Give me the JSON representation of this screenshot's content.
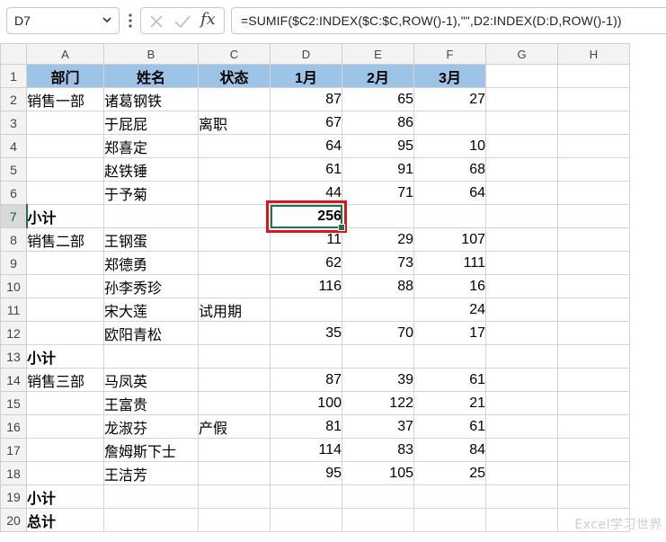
{
  "formula_bar": {
    "name_box": "D7",
    "formula": "=SUMIF($C2:INDEX($C:$C,ROW()-1),\"\",D2:INDEX(D:D,ROW()-1))",
    "fx_label": "fx"
  },
  "columns": [
    "A",
    "B",
    "C",
    "D",
    "E",
    "F",
    "G",
    "H"
  ],
  "selected_cell": {
    "col": "D",
    "row": "7"
  },
  "rows": [
    {
      "num": "1",
      "cells": [
        "部门",
        "姓名",
        "状态",
        "1月",
        "2月",
        "3月",
        "",
        ""
      ]
    },
    {
      "num": "2",
      "cells": [
        "销售一部",
        "诸葛钢铁",
        "",
        "87",
        "65",
        "27",
        "",
        ""
      ]
    },
    {
      "num": "3",
      "cells": [
        "",
        "于屁屁",
        "离职",
        "67",
        "86",
        "",
        "",
        ""
      ]
    },
    {
      "num": "4",
      "cells": [
        "",
        "郑喜定",
        "",
        "64",
        "95",
        "10",
        "",
        ""
      ]
    },
    {
      "num": "5",
      "cells": [
        "",
        "赵铁锤",
        "",
        "61",
        "91",
        "68",
        "",
        ""
      ]
    },
    {
      "num": "6",
      "cells": [
        "",
        "于予菊",
        "",
        "44",
        "71",
        "64",
        "",
        ""
      ]
    },
    {
      "num": "7",
      "cells": [
        "小计",
        "",
        "",
        "256",
        "",
        "",
        "",
        ""
      ]
    },
    {
      "num": "8",
      "cells": [
        "销售二部",
        "王钢蛋",
        "",
        "11",
        "29",
        "107",
        "",
        ""
      ]
    },
    {
      "num": "9",
      "cells": [
        "",
        "郑德勇",
        "",
        "62",
        "73",
        "111",
        "",
        ""
      ]
    },
    {
      "num": "10",
      "cells": [
        "",
        "孙李秀珍",
        "",
        "116",
        "88",
        "16",
        "",
        ""
      ]
    },
    {
      "num": "11",
      "cells": [
        "",
        "宋大莲",
        "试用期",
        "",
        "",
        "24",
        "",
        ""
      ]
    },
    {
      "num": "12",
      "cells": [
        "",
        "欧阳青松",
        "",
        "35",
        "70",
        "17",
        "",
        ""
      ]
    },
    {
      "num": "13",
      "cells": [
        "小计",
        "",
        "",
        "",
        "",
        "",
        "",
        ""
      ]
    },
    {
      "num": "14",
      "cells": [
        "销售三部",
        "马凤英",
        "",
        "87",
        "39",
        "61",
        "",
        ""
      ]
    },
    {
      "num": "15",
      "cells": [
        "",
        "王富贵",
        "",
        "100",
        "122",
        "21",
        "",
        ""
      ]
    },
    {
      "num": "16",
      "cells": [
        "",
        "龙淑芬",
        "产假",
        "81",
        "37",
        "61",
        "",
        ""
      ]
    },
    {
      "num": "17",
      "cells": [
        "",
        "詹姆斯下士",
        "",
        "114",
        "83",
        "84",
        "",
        ""
      ]
    },
    {
      "num": "18",
      "cells": [
        "",
        "王洁芳",
        "",
        "95",
        "105",
        "25",
        "",
        ""
      ]
    },
    {
      "num": "19",
      "cells": [
        "小计",
        "",
        "",
        "",
        "",
        "",
        "",
        ""
      ]
    },
    {
      "num": "20",
      "cells": [
        "总计",
        "",
        "",
        "",
        "",
        "",
        "",
        ""
      ]
    }
  ],
  "watermark": "Excel学习世界",
  "colors": {
    "header_fill": "#9dc3e6",
    "selection_green": "#217346",
    "highlight_red": "#e0141e"
  }
}
